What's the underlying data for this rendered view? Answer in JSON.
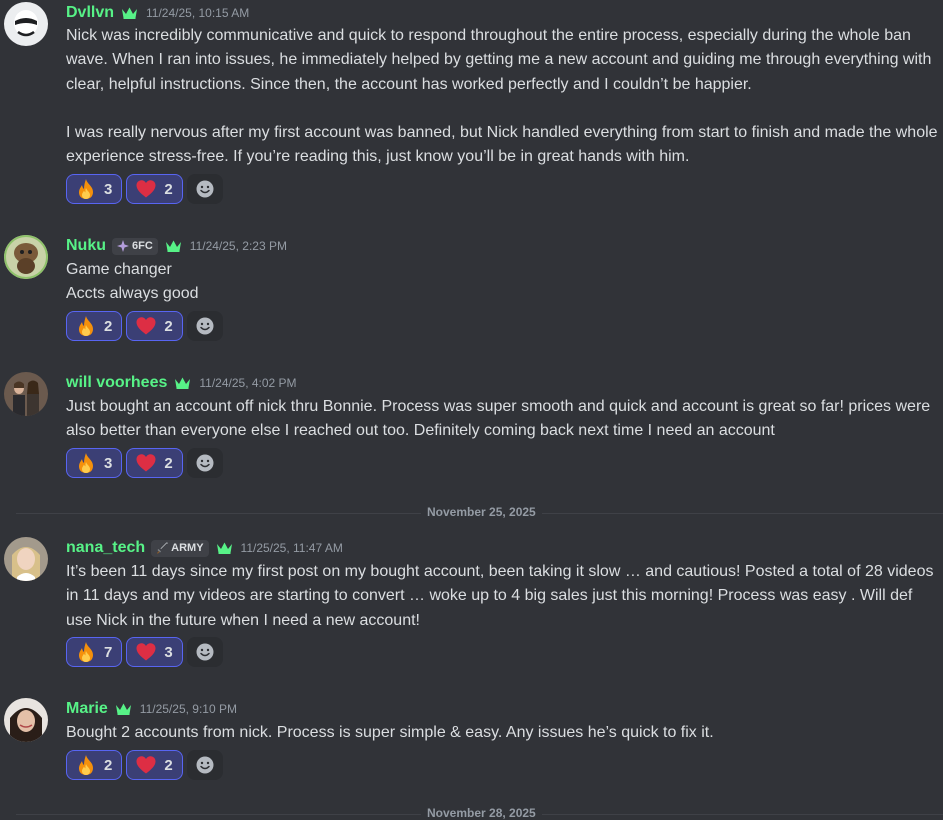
{
  "messages": [
    {
      "username": "Dvllvn",
      "timestamp": "11/24/25, 10:15 AM",
      "paragraphs": [
        "Nick was incredibly communicative and quick to respond throughout the entire process, especially during the whole ban wave. When I ran into issues, he immediately helped by getting me a new account and guiding me through everything with clear, helpful instructions. Since then, the account has worked perfectly and I couldn’t be happier.",
        "I was really nervous after my first account was banned, but Nick handled everything from start to finish and made the whole experience stress-free. If you’re reading this, just know you’ll be in great hands with him."
      ],
      "reactions": [
        {
          "icon": "fire-emoji",
          "count": "3"
        },
        {
          "icon": "heart-emoji",
          "count": "2"
        }
      ]
    },
    {
      "username": "Nuku",
      "tag": "6FC",
      "timestamp": "11/24/25, 2:23 PM",
      "lines": [
        "Game changer",
        "Accts always good"
      ],
      "reactions": [
        {
          "icon": "fire-emoji",
          "count": "2"
        },
        {
          "icon": "heart-emoji",
          "count": "2"
        }
      ]
    },
    {
      "username": "will voorhees",
      "timestamp": "11/24/25, 4:02 PM",
      "text": "Just bought an account off nick thru Bonnie. Process was super smooth and quick and account is great so far!  prices were also better than everyone else I reached out too. Definitely coming back next time I need an account",
      "reactions": [
        {
          "icon": "fire-emoji",
          "count": "3"
        },
        {
          "icon": "heart-emoji",
          "count": "2"
        }
      ]
    },
    {
      "username": "nana_tech",
      "tag": "ARMY",
      "timestamp": "11/25/25, 11:47 AM",
      "text": "It’s been 11 days since my first post on my bought account, been taking it slow … and cautious! Posted a total of 28 videos in 11 days and my videos are starting to convert … woke up to 4 big sales just this morning! Process was easy . Will def use Nick in the future when I need a new account!",
      "reactions": [
        {
          "icon": "fire-emoji",
          "count": "7"
        },
        {
          "icon": "heart-emoji",
          "count": "3"
        }
      ]
    },
    {
      "username": "Marie",
      "timestamp": "11/25/25, 9:10 PM",
      "text": "Bought 2 accounts from nick. Process is super simple & easy. Any issues he’s quick to fix it.",
      "reactions": [
        {
          "icon": "fire-emoji",
          "count": "2"
        },
        {
          "icon": "heart-emoji",
          "count": "2"
        }
      ]
    }
  ],
  "dividers": [
    "November 25, 2025",
    "November 28, 2025"
  ],
  "colors": {
    "username": "#57f287",
    "background": "#313338",
    "reaction_bg": "#3b3f75",
    "reaction_border": "#5865f2"
  }
}
